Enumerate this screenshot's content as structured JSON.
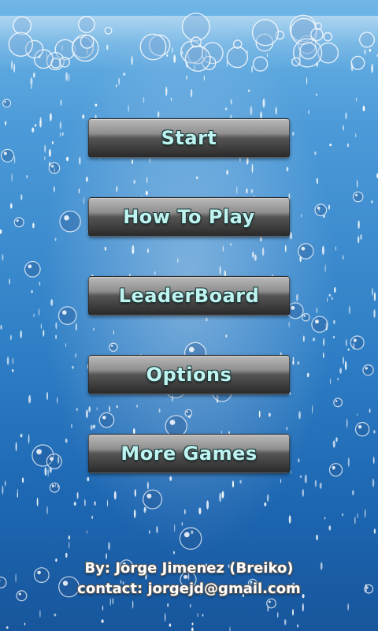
{
  "menu": {
    "start_label": "Start",
    "how_to_play_label": "How To Play",
    "leaderboard_label": "LeaderBoard",
    "options_label": "Options",
    "more_games_label": "More Games"
  },
  "credits": {
    "author": "By: Jorge Jimenez (Breiko)",
    "contact": "contact: jorgejd@gmail.com"
  },
  "colors": {
    "button_text": "#bff3f0",
    "background_water": "#2f7fc6"
  }
}
